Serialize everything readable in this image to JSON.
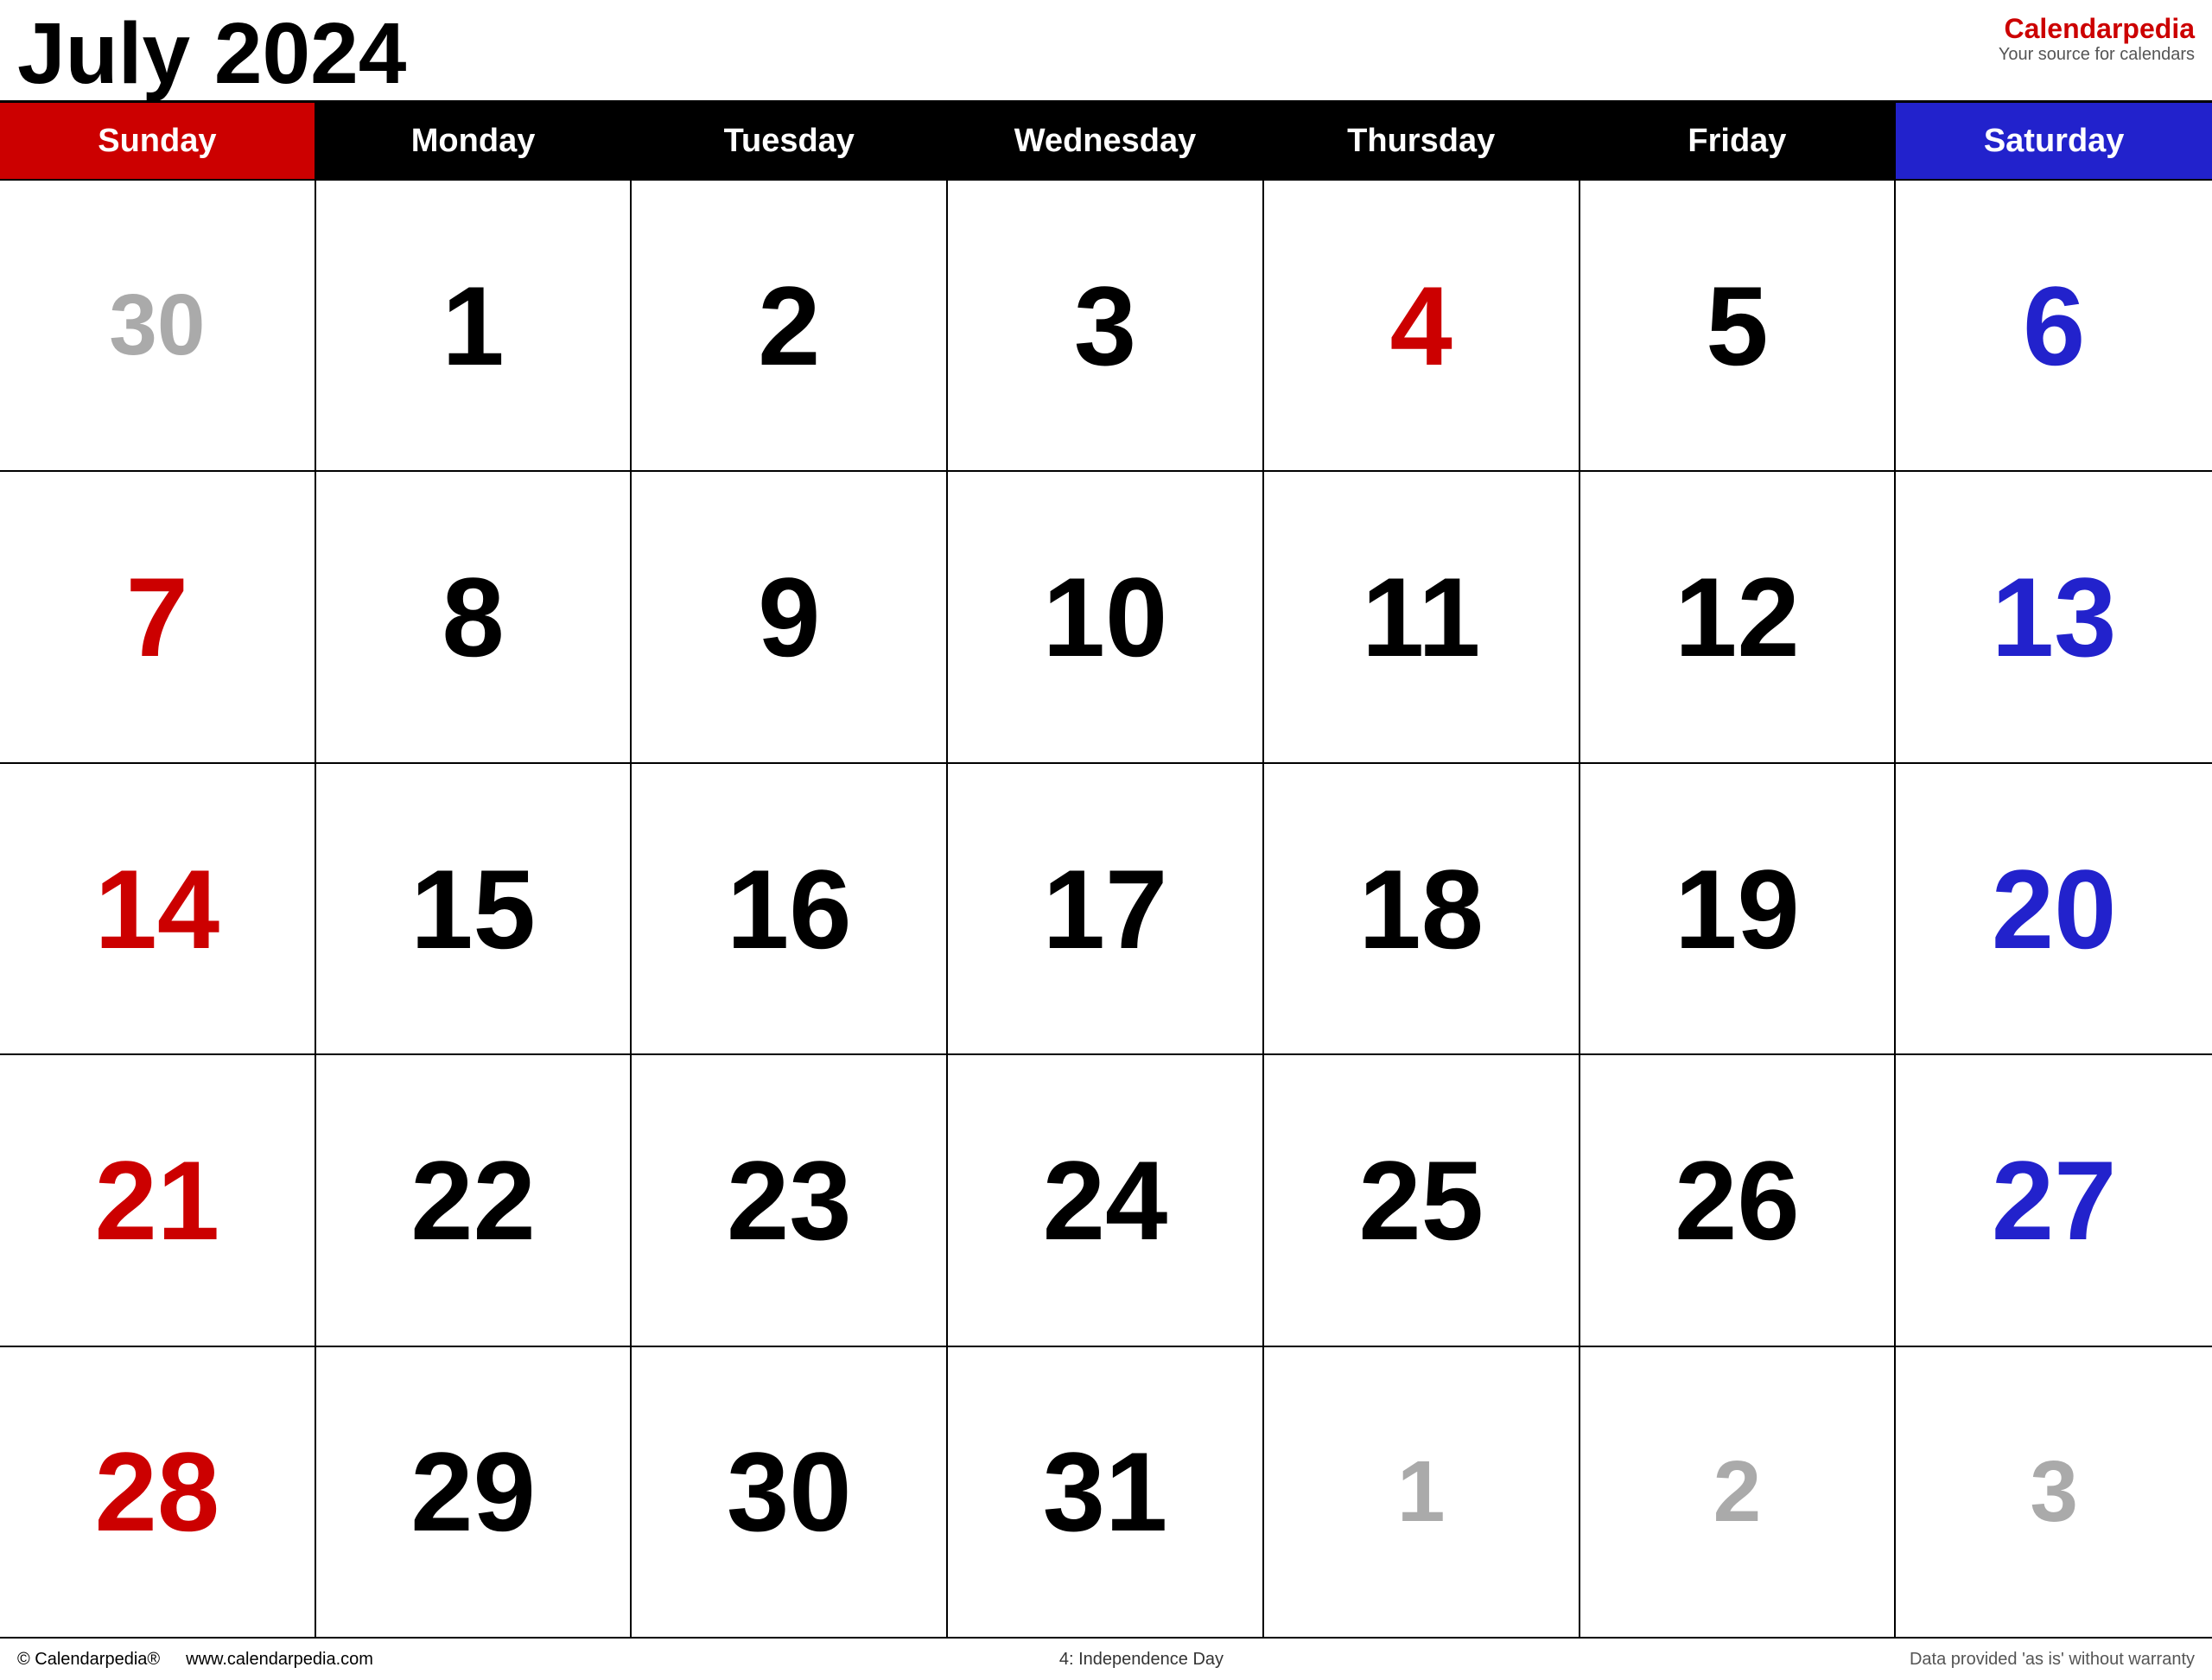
{
  "header": {
    "title": "July 2024",
    "brand_name": "Calendar",
    "brand_name_accent": "pedia",
    "brand_tagline": "Your source for calendars"
  },
  "colors": {
    "sunday": "#cc0000",
    "saturday": "#2222cc",
    "black": "#000000",
    "gray": "#aaaaaa",
    "holiday": "#cc0000"
  },
  "day_headers": [
    {
      "label": "Sunday",
      "type": "sunday"
    },
    {
      "label": "Monday",
      "type": "weekday"
    },
    {
      "label": "Tuesday",
      "type": "weekday"
    },
    {
      "label": "Wednesday",
      "type": "weekday"
    },
    {
      "label": "Thursday",
      "type": "weekday"
    },
    {
      "label": "Friday",
      "type": "weekday"
    },
    {
      "label": "Saturday",
      "type": "saturday"
    }
  ],
  "weeks": [
    [
      {
        "day": "30",
        "type": "other-month"
      },
      {
        "day": "1",
        "type": "weekday"
      },
      {
        "day": "2",
        "type": "weekday"
      },
      {
        "day": "3",
        "type": "weekday"
      },
      {
        "day": "4",
        "type": "holiday"
      },
      {
        "day": "5",
        "type": "weekday"
      },
      {
        "day": "6",
        "type": "saturday"
      }
    ],
    [
      {
        "day": "7",
        "type": "sunday"
      },
      {
        "day": "8",
        "type": "weekday"
      },
      {
        "day": "9",
        "type": "weekday"
      },
      {
        "day": "10",
        "type": "weekday"
      },
      {
        "day": "11",
        "type": "weekday"
      },
      {
        "day": "12",
        "type": "weekday"
      },
      {
        "day": "13",
        "type": "saturday"
      }
    ],
    [
      {
        "day": "14",
        "type": "sunday"
      },
      {
        "day": "15",
        "type": "weekday"
      },
      {
        "day": "16",
        "type": "weekday"
      },
      {
        "day": "17",
        "type": "weekday"
      },
      {
        "day": "18",
        "type": "weekday"
      },
      {
        "day": "19",
        "type": "weekday"
      },
      {
        "day": "20",
        "type": "saturday"
      }
    ],
    [
      {
        "day": "21",
        "type": "sunday"
      },
      {
        "day": "22",
        "type": "weekday"
      },
      {
        "day": "23",
        "type": "weekday"
      },
      {
        "day": "24",
        "type": "weekday"
      },
      {
        "day": "25",
        "type": "weekday"
      },
      {
        "day": "26",
        "type": "weekday"
      },
      {
        "day": "27",
        "type": "saturday"
      }
    ],
    [
      {
        "day": "28",
        "type": "sunday"
      },
      {
        "day": "29",
        "type": "weekday"
      },
      {
        "day": "30",
        "type": "weekday"
      },
      {
        "day": "31",
        "type": "weekday"
      },
      {
        "day": "1",
        "type": "other-month"
      },
      {
        "day": "2",
        "type": "other-month"
      },
      {
        "day": "3",
        "type": "other-month"
      }
    ]
  ],
  "footer": {
    "copyright": "© Calendarpedia®",
    "website": "www.calendarpedia.com",
    "holiday_note": "4: Independence Day",
    "disclaimer": "Data provided 'as is' without warranty"
  }
}
